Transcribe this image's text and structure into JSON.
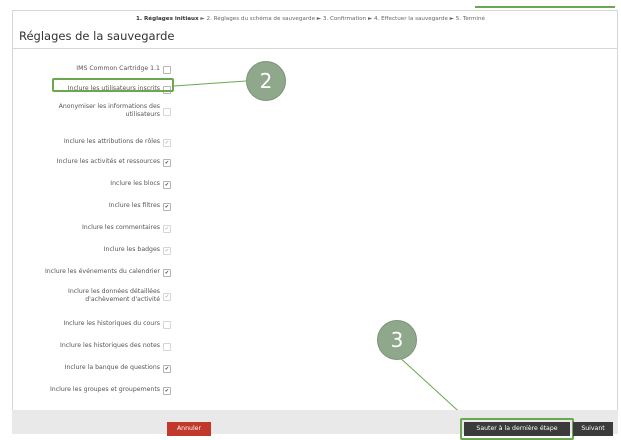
{
  "steps": {
    "current": "1. Réglages initiaux",
    "rest": " ► 2. Réglages du schéma de sauvegarde ► 3. Confirmation ► 4. Effectuer la sauvegarde ► 5. Terminé"
  },
  "title": "Réglages de la sauvegarde",
  "settings": [
    {
      "label": "IMS Common Cartridge 1.1",
      "checked": false,
      "disabled": false
    },
    {
      "label": "Inclure les utilisateurs inscrits",
      "checked": false,
      "disabled": false
    },
    {
      "label": "Anonymiser les informations des utilisateurs",
      "checked": false,
      "disabled": true
    },
    {
      "label": "Inclure les attributions de rôles",
      "checked": true,
      "disabled": true
    },
    {
      "label": "Inclure les activités et ressources",
      "checked": true,
      "disabled": false
    },
    {
      "label": "Inclure les blocs",
      "checked": true,
      "disabled": false
    },
    {
      "label": "Inclure les filtres",
      "checked": true,
      "disabled": false
    },
    {
      "label": "Inclure les commentaires",
      "checked": true,
      "disabled": true
    },
    {
      "label": "Inclure les badges",
      "checked": true,
      "disabled": true
    },
    {
      "label": "Inclure les événements du calendrier",
      "checked": true,
      "disabled": false
    },
    {
      "label": "Inclure les données détaillées d'achèvement d'activité",
      "checked": true,
      "disabled": true
    },
    {
      "label": "Inclure les historiques du cours",
      "checked": false,
      "disabled": true
    },
    {
      "label": "Inclure les historiques des notes",
      "checked": false,
      "disabled": true
    },
    {
      "label": "Inclure la banque de questions",
      "checked": true,
      "disabled": false
    },
    {
      "label": "Inclure les groupes et groupements",
      "checked": true,
      "disabled": false
    }
  ],
  "callouts": [
    "2",
    "3"
  ],
  "buttons": {
    "cancel": "Annuler",
    "skip": "Sauter à la dernière étape",
    "next": "Suivant"
  },
  "colors": {
    "highlight": "#6aa84f",
    "cancel": "#c0392b",
    "dark_button": "#3b3b3b"
  }
}
